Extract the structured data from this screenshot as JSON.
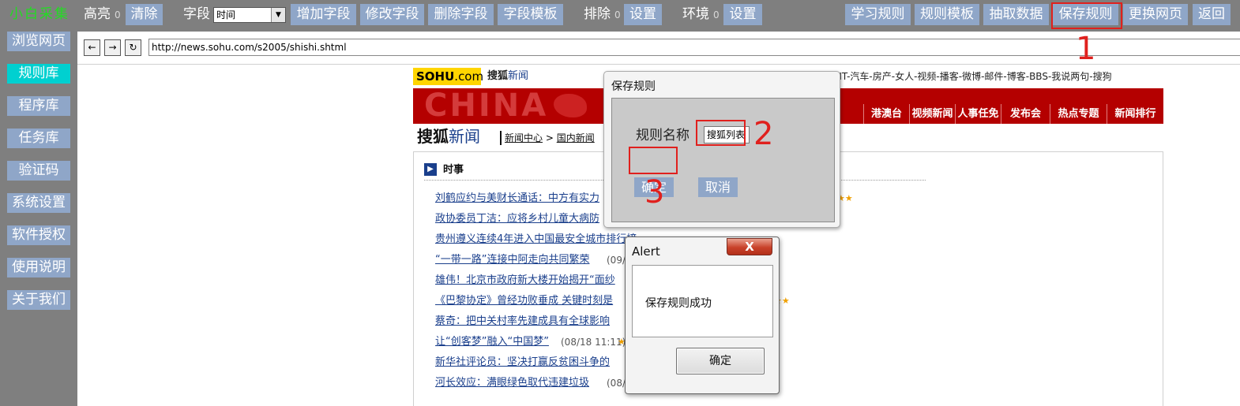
{
  "toolbar": {
    "app_title": "小白采集",
    "highlight_label": "高亮",
    "highlight_count": "0",
    "clear_button": "清除",
    "field_label": "字段",
    "field_select_value": "时间",
    "add_field": "增加字段",
    "edit_field": "修改字段",
    "delete_field": "删除字段",
    "field_template": "字段模板",
    "exclude_label": "排除",
    "exclude_count": "0",
    "exclude_settings": "设置",
    "env_label": "环境",
    "env_count": "0",
    "env_settings": "设置",
    "learn_rule": "学习规则",
    "rule_template": "规则模板",
    "extract_data": "抽取数据",
    "save_rule": "保存规则",
    "change_page": "更换网页",
    "back": "返回"
  },
  "sidebar": {
    "items": [
      {
        "label": "浏览网页"
      },
      {
        "label": "规则库"
      },
      {
        "label": "程序库"
      },
      {
        "label": "任务库"
      },
      {
        "label": "验证码"
      },
      {
        "label": "系统设置"
      },
      {
        "label": "软件授权"
      },
      {
        "label": "使用说明"
      },
      {
        "label": "关于我们"
      }
    ],
    "active_index": 1
  },
  "address_bar": {
    "back_icon": "←",
    "forward_icon": "→",
    "refresh_icon": "↻",
    "url": "http://news.sohu.com/s2005/shishi.shtml"
  },
  "web_page": {
    "logo": "SOHU",
    "logo_suffix": ".com",
    "brand_news_prefix": "搜狐",
    "brand_news": "新闻",
    "top_nav": "-IT-汽车-房产-女人-视频-播客-微博-邮件-博客-BBS-我说两句-搜狗",
    "banner_text": "CHINA",
    "banner_tabs": [
      "港澳台",
      "视频新闻",
      "人事任免",
      "发布会",
      "热点专题",
      "新闻排行"
    ],
    "heading_prefix": "搜狐",
    "heading_suffix": "新闻",
    "breadcrumb_1": "新闻中心",
    "breadcrumb_sep": ">",
    "breadcrumb_2": "国内新闻",
    "section_icon": "▶",
    "section_title": "时事",
    "news": [
      {
        "title": "刘鹤应约与美财长通话：中方有实力",
        "date": "",
        "stars": "★★"
      },
      {
        "title": "政协委员丁洁：应将乡村儿童大病防",
        "date": "",
        "stars": ""
      },
      {
        "title": "贵州遵义连续4年进入中国最安全城市排行榜",
        "date": "",
        "stars": ""
      },
      {
        "title": "“一带一路”连接中阿走向共同繁荣",
        "date": "(09/",
        "stars": ""
      },
      {
        "title": "雄伟！北京市政府新大楼开始揭开“面纱",
        "date": "",
        "stars": ""
      },
      {
        "title": "《巴黎协定》曾经功败垂成 关键时刻是",
        "date": "",
        "stars": "★★"
      },
      {
        "title": "蔡奇：把中关村率先建成具有全球影响",
        "date": "",
        "stars": ""
      },
      {
        "title": "让“创客梦”融入“中国梦”",
        "date": "(08/18 11:11)",
        "stars": "★"
      },
      {
        "title": "新华社评论员：坚决打赢反贫困斗争的",
        "date": "",
        "stars": ""
      },
      {
        "title": "河长效应：满眼绿色取代违建垃圾",
        "date": "(08/",
        "stars": ""
      }
    ]
  },
  "save_dialog": {
    "title": "保存规则",
    "name_label": "规则名称",
    "name_value": "搜狐列表",
    "confirm": "确定",
    "cancel": "取消"
  },
  "alert": {
    "title": "Alert",
    "close_icon": "X",
    "message": "保存规则成功",
    "ok": "确定"
  },
  "annotations": {
    "step1": "1",
    "step2": "2",
    "step3": "3",
    "color": "#e0201d"
  },
  "colors": {
    "toolbar_bg": "#7f7f7f",
    "button_bg": "#8fa6c8",
    "active_item": "#00d0d0",
    "app_title": "#22dd22"
  }
}
